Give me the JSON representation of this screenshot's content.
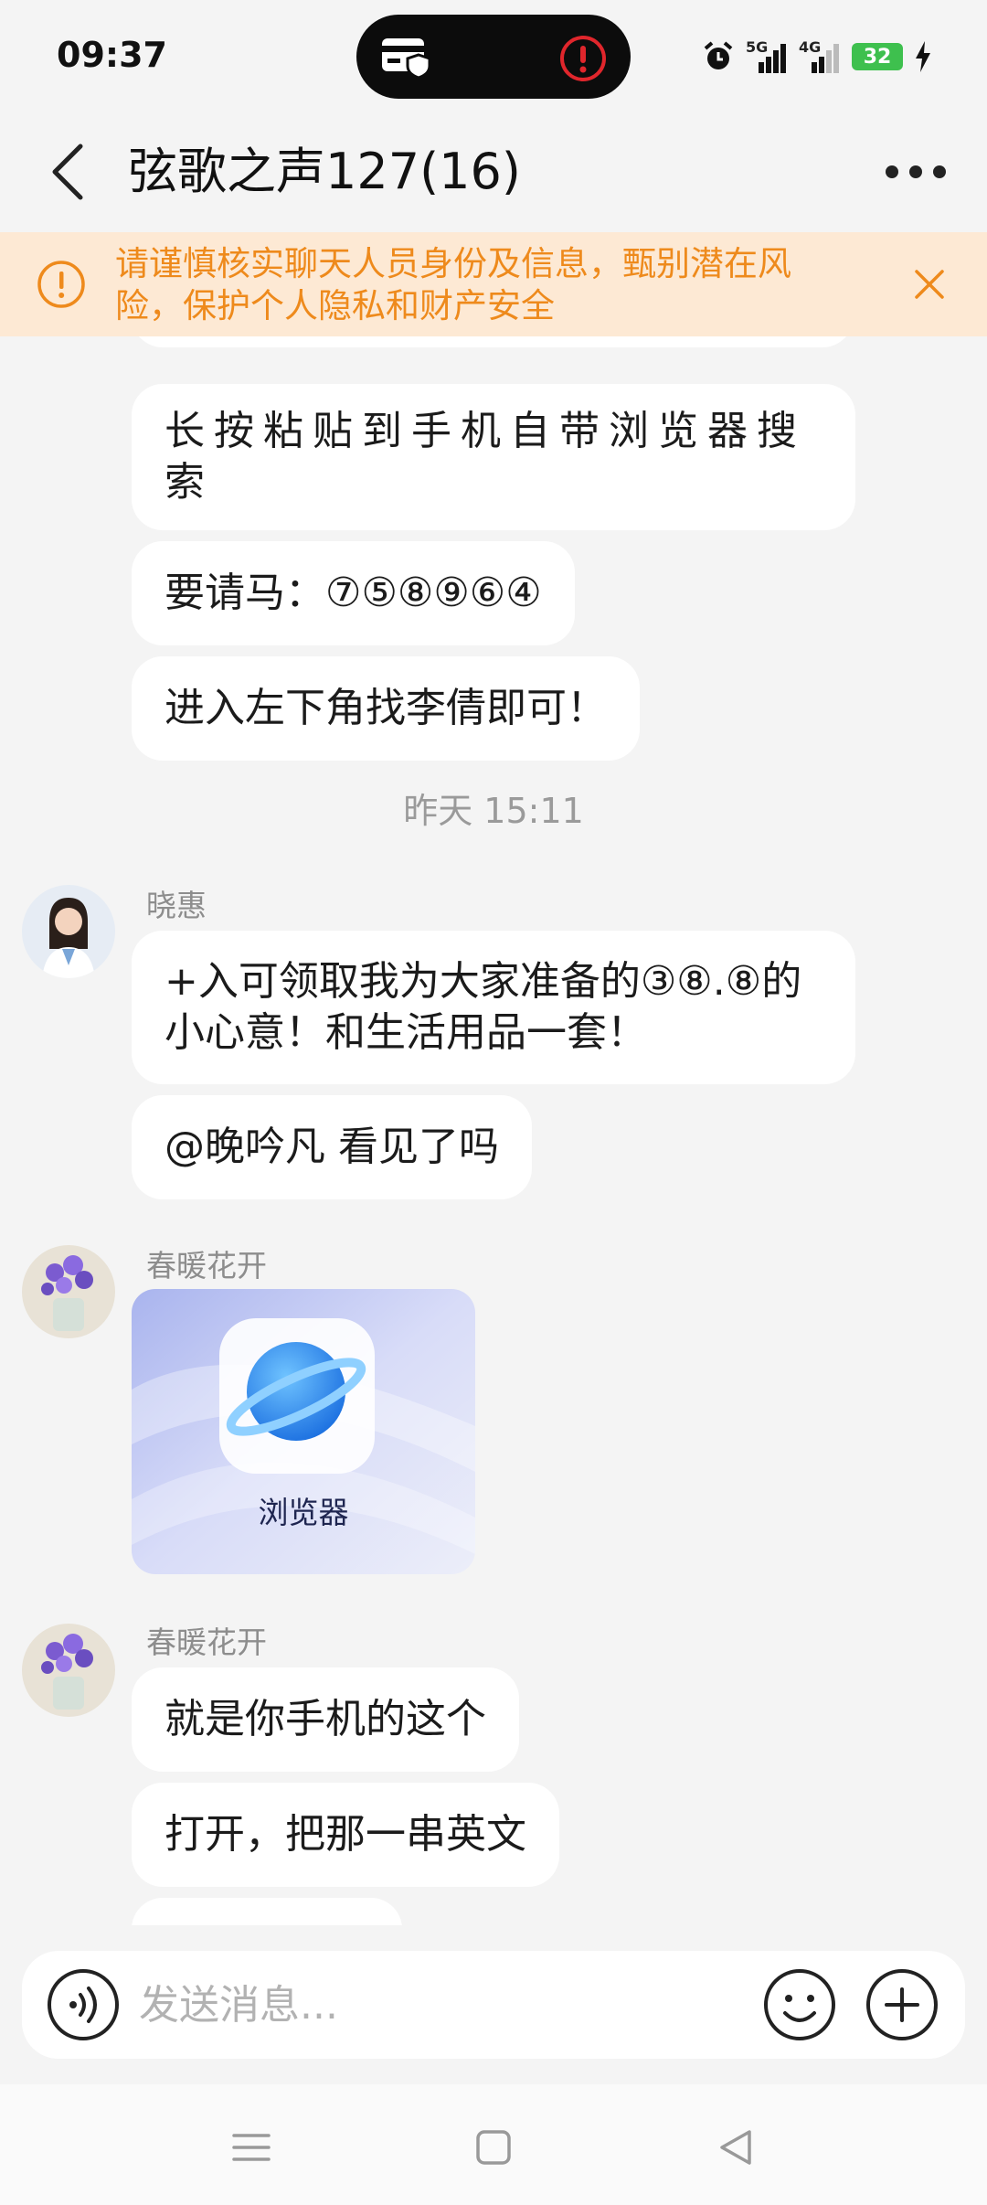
{
  "status_bar": {
    "time": "09:37",
    "network_1": "5G",
    "network_2": "4G",
    "battery": "32"
  },
  "header": {
    "title": "弦歌之声127(16)"
  },
  "warning": {
    "text": "请谨慎核实聊天人员身份及信息，甄别潜在风险，保护个人隐私和财产安全"
  },
  "messages": {
    "m1": "长按粘贴到手机自带浏览器搜索",
    "m2": "要请马：⑦⑤⑧⑨⑥④",
    "m3": "进入左下角找李倩即可！",
    "timestamp": "昨天 15:11",
    "sender1": "晓惠",
    "m4": "+入可领取我为大家准备的③⑧.⑧的小心意！和生活用品一套！",
    "m5": "@晚吟凡 看见了吗",
    "sender2": "春暖花开",
    "image_label": "浏览器",
    "sender3": "春暖花开",
    "m6": "就是你手机的这个",
    "m7": "打开，把那一串英文"
  },
  "input": {
    "placeholder": "发送消息..."
  },
  "colors": {
    "accent_warning": "#ee8a1c",
    "warning_bg": "#fde9d4",
    "page_bg": "#f4f4f4"
  }
}
